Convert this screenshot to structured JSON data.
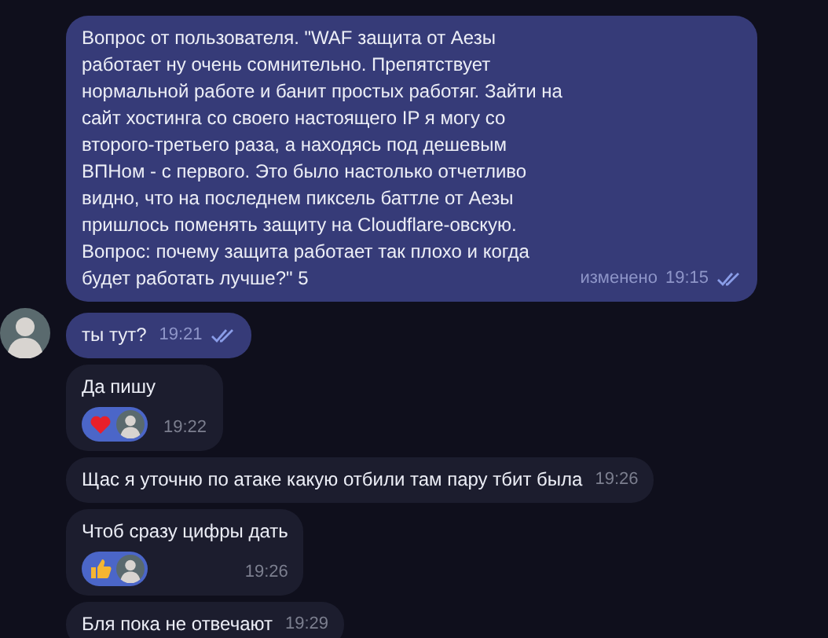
{
  "messages": [
    {
      "kind": "out",
      "text": "Вопрос от пользователя.  \"WAF защита от Аезы работает ну очень сомнительно. Препятствует нормальной работе и банит простых работяг. Зайти на сайт хостинга со своего настоящего IP я могу со второго-третьего раза, а находясь под дешевым ВПНом - с первого. Это было настолько отчетливо видно, что на последнем пиксель баттле от Аезы пришлось поменять защиту на Cloudflare-овскую. Вопрос: почему защита работает так плохо и когда будет работать лучше?\" 5",
      "edited": "изменено",
      "time": "19:15",
      "read": true,
      "avatar": false
    },
    {
      "kind": "out",
      "text": "ты тут?",
      "time": "19:21",
      "read": true,
      "avatar": true
    },
    {
      "kind": "in",
      "text": "Да пишу",
      "time": "19:22",
      "reactions": [
        {
          "kind": "heart"
        }
      ]
    },
    {
      "kind": "in",
      "text": "Щас я уточню по атаке какую отбили там пару тбит была",
      "time": "19:26"
    },
    {
      "kind": "in",
      "text": "Чтоб сразу цифры дать",
      "time": "19:26",
      "reactions": [
        {
          "kind": "thumbs"
        }
      ]
    },
    {
      "kind": "in",
      "text": "Бля пока не отвечают",
      "time": "19:29"
    }
  ]
}
